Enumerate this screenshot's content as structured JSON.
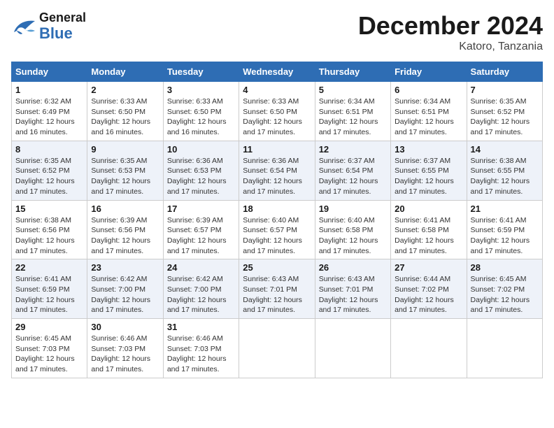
{
  "header": {
    "logo_general": "General",
    "logo_blue": "Blue",
    "month": "December 2024",
    "location": "Katoro, Tanzania"
  },
  "days_of_week": [
    "Sunday",
    "Monday",
    "Tuesday",
    "Wednesday",
    "Thursday",
    "Friday",
    "Saturday"
  ],
  "weeks": [
    [
      {
        "day": "1",
        "info": "Sunrise: 6:32 AM\nSunset: 6:49 PM\nDaylight: 12 hours and 16 minutes."
      },
      {
        "day": "2",
        "info": "Sunrise: 6:33 AM\nSunset: 6:50 PM\nDaylight: 12 hours and 16 minutes."
      },
      {
        "day": "3",
        "info": "Sunrise: 6:33 AM\nSunset: 6:50 PM\nDaylight: 12 hours and 16 minutes."
      },
      {
        "day": "4",
        "info": "Sunrise: 6:33 AM\nSunset: 6:50 PM\nDaylight: 12 hours and 17 minutes."
      },
      {
        "day": "5",
        "info": "Sunrise: 6:34 AM\nSunset: 6:51 PM\nDaylight: 12 hours and 17 minutes."
      },
      {
        "day": "6",
        "info": "Sunrise: 6:34 AM\nSunset: 6:51 PM\nDaylight: 12 hours and 17 minutes."
      },
      {
        "day": "7",
        "info": "Sunrise: 6:35 AM\nSunset: 6:52 PM\nDaylight: 12 hours and 17 minutes."
      }
    ],
    [
      {
        "day": "8",
        "info": "Sunrise: 6:35 AM\nSunset: 6:52 PM\nDaylight: 12 hours and 17 minutes."
      },
      {
        "day": "9",
        "info": "Sunrise: 6:35 AM\nSunset: 6:53 PM\nDaylight: 12 hours and 17 minutes."
      },
      {
        "day": "10",
        "info": "Sunrise: 6:36 AM\nSunset: 6:53 PM\nDaylight: 12 hours and 17 minutes."
      },
      {
        "day": "11",
        "info": "Sunrise: 6:36 AM\nSunset: 6:54 PM\nDaylight: 12 hours and 17 minutes."
      },
      {
        "day": "12",
        "info": "Sunrise: 6:37 AM\nSunset: 6:54 PM\nDaylight: 12 hours and 17 minutes."
      },
      {
        "day": "13",
        "info": "Sunrise: 6:37 AM\nSunset: 6:55 PM\nDaylight: 12 hours and 17 minutes."
      },
      {
        "day": "14",
        "info": "Sunrise: 6:38 AM\nSunset: 6:55 PM\nDaylight: 12 hours and 17 minutes."
      }
    ],
    [
      {
        "day": "15",
        "info": "Sunrise: 6:38 AM\nSunset: 6:56 PM\nDaylight: 12 hours and 17 minutes."
      },
      {
        "day": "16",
        "info": "Sunrise: 6:39 AM\nSunset: 6:56 PM\nDaylight: 12 hours and 17 minutes."
      },
      {
        "day": "17",
        "info": "Sunrise: 6:39 AM\nSunset: 6:57 PM\nDaylight: 12 hours and 17 minutes."
      },
      {
        "day": "18",
        "info": "Sunrise: 6:40 AM\nSunset: 6:57 PM\nDaylight: 12 hours and 17 minutes."
      },
      {
        "day": "19",
        "info": "Sunrise: 6:40 AM\nSunset: 6:58 PM\nDaylight: 12 hours and 17 minutes."
      },
      {
        "day": "20",
        "info": "Sunrise: 6:41 AM\nSunset: 6:58 PM\nDaylight: 12 hours and 17 minutes."
      },
      {
        "day": "21",
        "info": "Sunrise: 6:41 AM\nSunset: 6:59 PM\nDaylight: 12 hours and 17 minutes."
      }
    ],
    [
      {
        "day": "22",
        "info": "Sunrise: 6:41 AM\nSunset: 6:59 PM\nDaylight: 12 hours and 17 minutes."
      },
      {
        "day": "23",
        "info": "Sunrise: 6:42 AM\nSunset: 7:00 PM\nDaylight: 12 hours and 17 minutes."
      },
      {
        "day": "24",
        "info": "Sunrise: 6:42 AM\nSunset: 7:00 PM\nDaylight: 12 hours and 17 minutes."
      },
      {
        "day": "25",
        "info": "Sunrise: 6:43 AM\nSunset: 7:01 PM\nDaylight: 12 hours and 17 minutes."
      },
      {
        "day": "26",
        "info": "Sunrise: 6:43 AM\nSunset: 7:01 PM\nDaylight: 12 hours and 17 minutes."
      },
      {
        "day": "27",
        "info": "Sunrise: 6:44 AM\nSunset: 7:02 PM\nDaylight: 12 hours and 17 minutes."
      },
      {
        "day": "28",
        "info": "Sunrise: 6:45 AM\nSunset: 7:02 PM\nDaylight: 12 hours and 17 minutes."
      }
    ],
    [
      {
        "day": "29",
        "info": "Sunrise: 6:45 AM\nSunset: 7:03 PM\nDaylight: 12 hours and 17 minutes."
      },
      {
        "day": "30",
        "info": "Sunrise: 6:46 AM\nSunset: 7:03 PM\nDaylight: 12 hours and 17 minutes."
      },
      {
        "day": "31",
        "info": "Sunrise: 6:46 AM\nSunset: 7:03 PM\nDaylight: 12 hours and 17 minutes."
      },
      {
        "day": "",
        "info": ""
      },
      {
        "day": "",
        "info": ""
      },
      {
        "day": "",
        "info": ""
      },
      {
        "day": "",
        "info": ""
      }
    ]
  ]
}
